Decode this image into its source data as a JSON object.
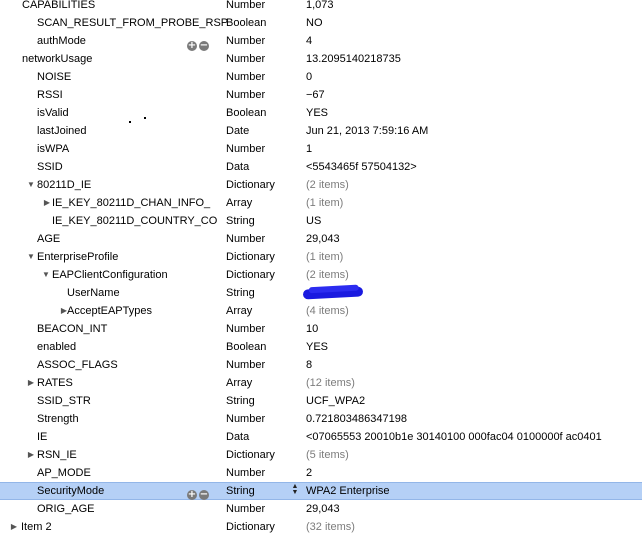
{
  "rows": [
    {
      "key": "CAPABILITIES",
      "type": "Number",
      "value": "1,073"
    },
    {
      "key": "SCAN_RESULT_FROM_PROBE_RSP",
      "type": "Boolean",
      "value": "NO"
    },
    {
      "key": "authMode",
      "type": "Number",
      "value": "4",
      "buttons": [
        "+",
        "−"
      ]
    },
    {
      "key": "networkUsage",
      "type": "Number",
      "value": "13.2095140218735"
    },
    {
      "key": "NOISE",
      "type": "Number",
      "value": "0"
    },
    {
      "key": "RSSI",
      "type": "Number",
      "value": "−67"
    },
    {
      "key": "isValid",
      "type": "Boolean",
      "value": "YES"
    },
    {
      "key": "lastJoined",
      "type": "Date",
      "value": "Jun 21, 2013 7:59:16 AM"
    },
    {
      "key": "isWPA",
      "type": "Number",
      "value": "1"
    },
    {
      "key": "SSID",
      "type": "Data",
      "value": "<5543465f 57504132>"
    },
    {
      "key": "80211D_IE",
      "type": "Dictionary",
      "value": "(2 items)",
      "disclosure": "expanded"
    },
    {
      "key": "IE_KEY_80211D_CHAN_INFO_",
      "type": "Array",
      "value": "(1 item)",
      "disclosure": "collapsed"
    },
    {
      "key": "IE_KEY_80211D_COUNTRY_CO",
      "type": "String",
      "value": "US"
    },
    {
      "key": "AGE",
      "type": "Number",
      "value": "29,043"
    },
    {
      "key": "EnterpriseProfile",
      "type": "Dictionary",
      "value": "(1 item)",
      "disclosure": "expanded"
    },
    {
      "key": "EAPClientConfiguration",
      "type": "Dictionary",
      "value": "(2 items)",
      "disclosure": "expanded"
    },
    {
      "key": "UserName",
      "type": "String",
      "value": "",
      "redacted": true
    },
    {
      "key": "AcceptEAPTypes",
      "type": "Array",
      "value": "(4 items)",
      "disclosure": "collapsed"
    },
    {
      "key": "BEACON_INT",
      "type": "Number",
      "value": "10"
    },
    {
      "key": "enabled",
      "type": "Boolean",
      "value": "YES"
    },
    {
      "key": "ASSOC_FLAGS",
      "type": "Number",
      "value": "8"
    },
    {
      "key": "RATES",
      "type": "Array",
      "value": "(12 items)",
      "disclosure": "collapsed"
    },
    {
      "key": "SSID_STR",
      "type": "String",
      "value": "UCF_WPA2"
    },
    {
      "key": "Strength",
      "type": "Number",
      "value": "0.721803486347198"
    },
    {
      "key": "IE",
      "type": "Data",
      "value": "<07065553 20010b1e 30140100 000fac04 0100000f ac0401"
    },
    {
      "key": "RSN_IE",
      "type": "Dictionary",
      "value": "(5 items)",
      "disclosure": "collapsed"
    },
    {
      "key": "AP_MODE",
      "type": "Number",
      "value": "2"
    },
    {
      "key": "SecurityMode",
      "type": "String",
      "value": "WPA2 Enterprise",
      "selected": true,
      "buttons": [
        "+",
        "−"
      ],
      "stepper": true
    },
    {
      "key": "ORIG_AGE",
      "type": "Number",
      "value": "29,043"
    },
    {
      "key": "Item 2",
      "type": "Dictionary",
      "value": "(32 items)",
      "disclosure": "collapsed"
    }
  ],
  "colors": {
    "selection": "#b5d0f6",
    "count_text": "#7c7c7c"
  },
  "icons": {
    "expanded": "disclosure-triangle-expanded-icon",
    "collapsed": "disclosure-triangle-collapsed-icon",
    "add": "add-circle-icon",
    "remove": "remove-circle-icon"
  }
}
